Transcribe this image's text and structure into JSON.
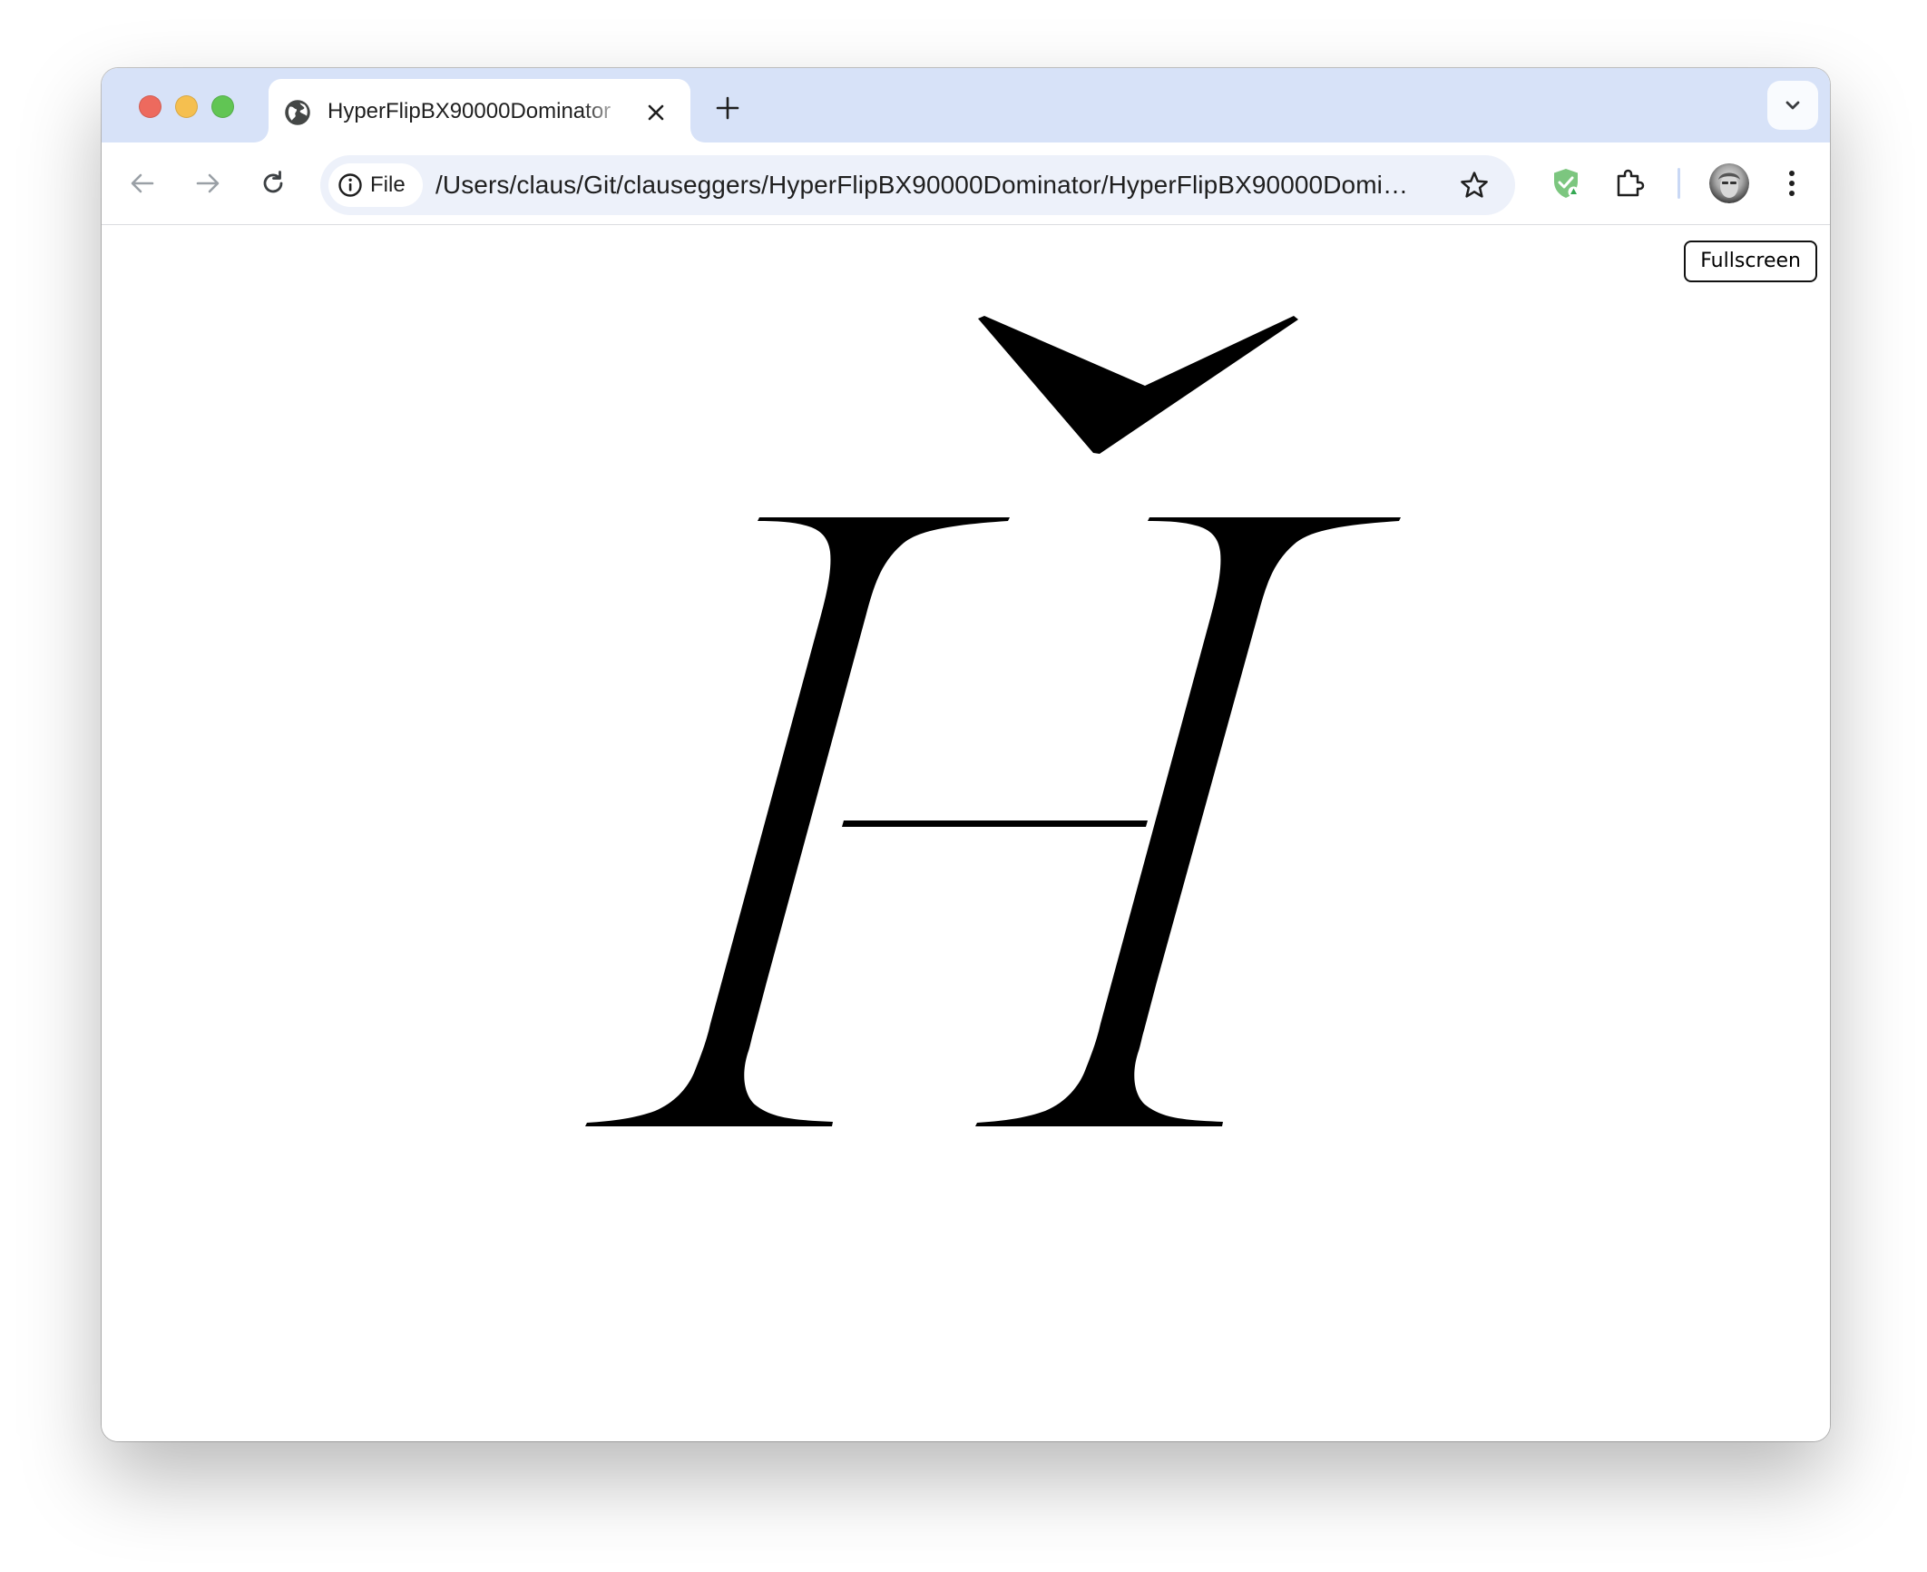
{
  "browser": {
    "tab": {
      "title": "HyperFlipBX90000Dominator"
    },
    "toolbar": {
      "site_chip_label": "File",
      "url": "/Users/claus/Git/clauseggers/HyperFlipBX90000Dominator/HyperFlipBX90000Dominator.html"
    }
  },
  "page": {
    "fullscreen_label": "Fullscreen",
    "glyph": {
      "character": "Й",
      "description": "cyrillic capital short i"
    }
  }
}
